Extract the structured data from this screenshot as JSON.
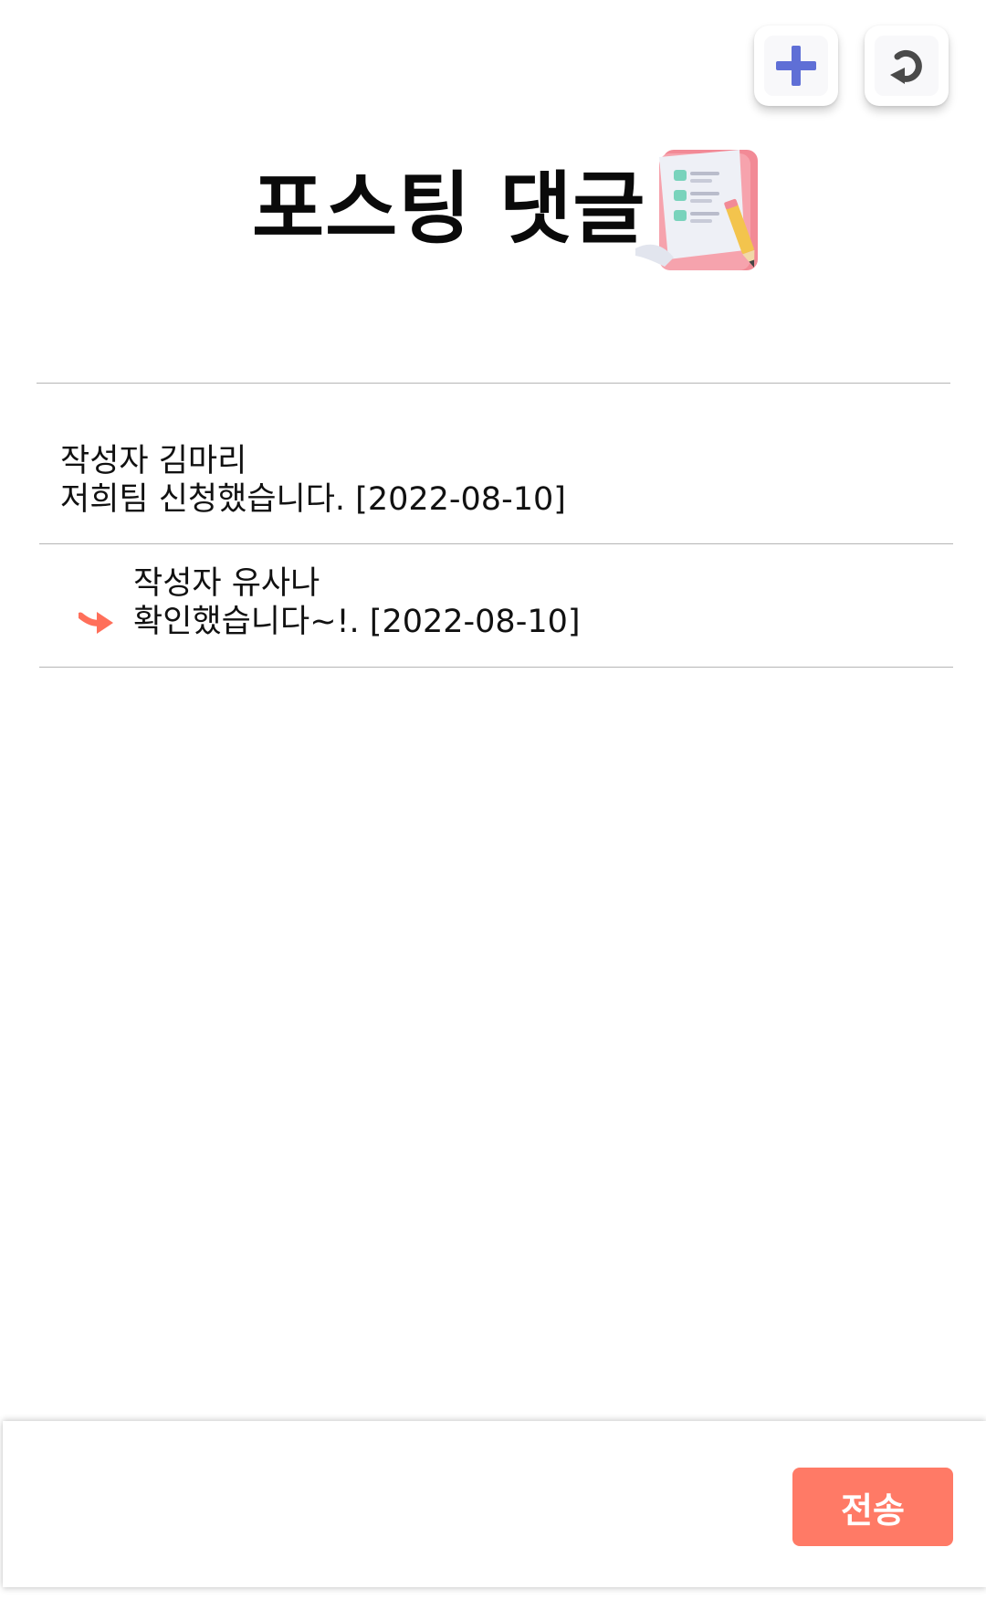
{
  "header": {
    "add_icon": "plus-icon",
    "refresh_icon": "undo-icon",
    "title": "포스팅 댓글",
    "title_icon": "checklist-icon"
  },
  "comments": [
    {
      "author": "작성자 김마리",
      "text": "저희팀 신청했습니다. [2022-08-10]",
      "is_reply": false
    },
    {
      "author": "작성자 유사나",
      "text": "확인했습니다~!. [2022-08-10]",
      "is_reply": true
    }
  ],
  "composer": {
    "input_value": "",
    "send_label": "전송"
  },
  "colors": {
    "accent": "#ff7a66",
    "plus": "#5f6fd6"
  }
}
